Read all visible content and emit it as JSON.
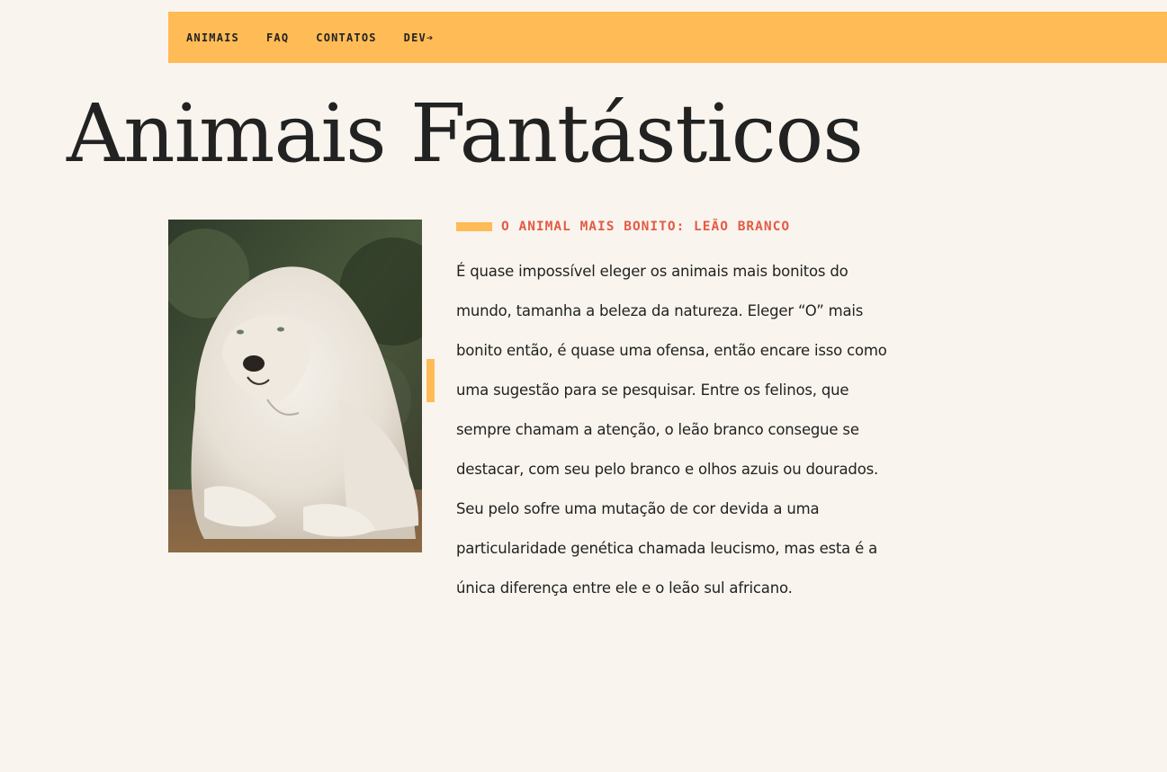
{
  "nav": {
    "items": [
      {
        "label": "ANIMAIS"
      },
      {
        "label": "FAQ"
      },
      {
        "label": "CONTATOS"
      },
      {
        "label": "DEV➔"
      }
    ]
  },
  "page_title": "Animais Fantásticos",
  "article": {
    "image_alt": "Leão Branco",
    "subtitle": "O ANIMAL MAIS BONITO: LEÃO BRANCO",
    "body": "É quase impossível eleger os animais mais bonitos do mundo, tamanha a beleza da natureza. Eleger “O” mais bonito então, é quase uma ofensa, então encare isso como uma sugestão para se pesquisar. Entre os felinos, que sempre chamam a atenção, o leão branco consegue se destacar, com seu pelo branco e olhos azuis ou dourados. Seu pelo sofre uma mutação de cor devida a uma particularidade genética chamada leucismo, mas esta é a única diferença entre ele e o leão sul africano."
  },
  "colors": {
    "background": "#f9f5ee",
    "accent": "#ffbb55",
    "subtitle": "#e55a45",
    "text": "#222222"
  }
}
